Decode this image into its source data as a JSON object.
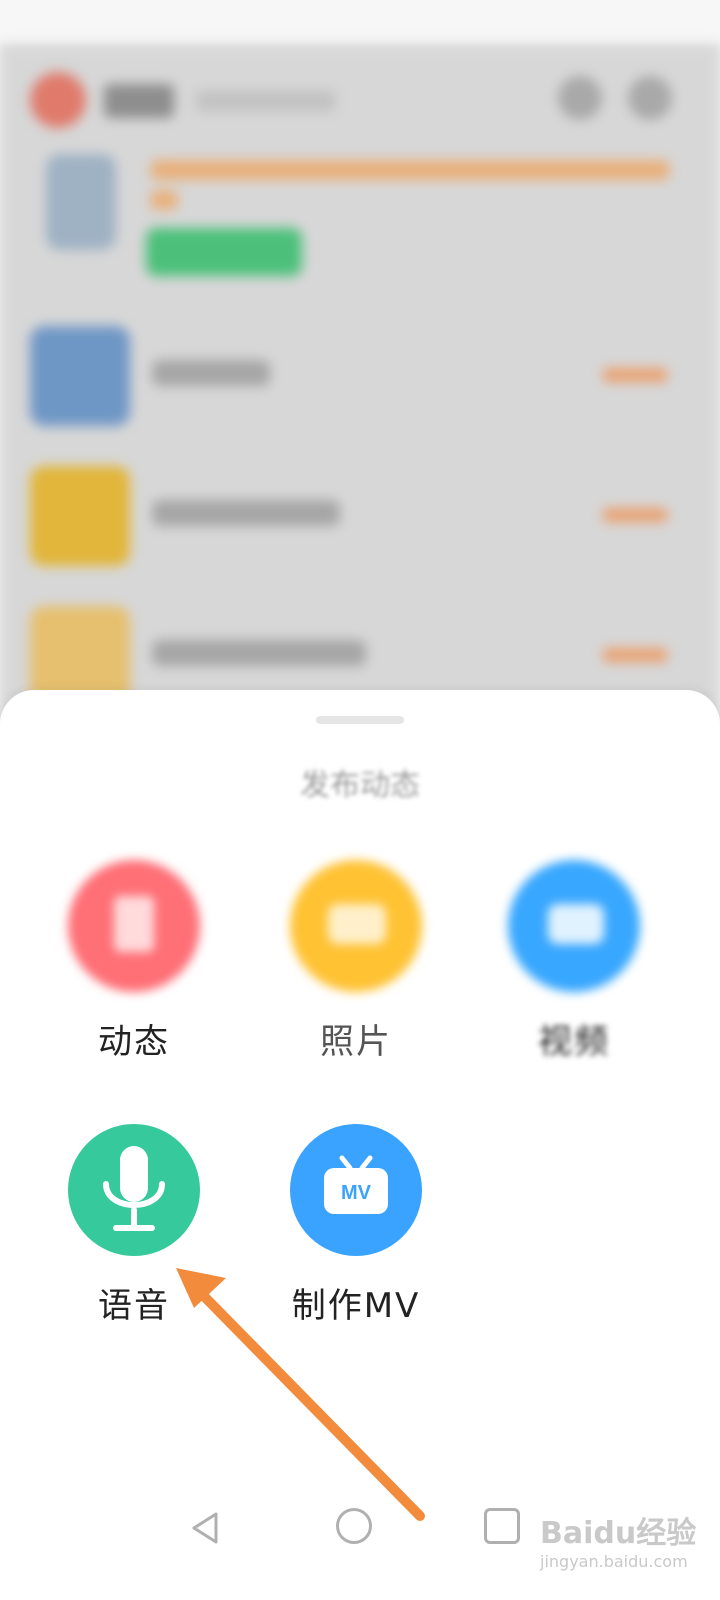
{
  "sheet": {
    "title": "发布动态",
    "actions": [
      {
        "label": "动态",
        "icon": "post-icon",
        "color": "#ff6f76"
      },
      {
        "label": "照片",
        "icon": "photo-icon",
        "color": "#ffc233"
      },
      {
        "label": "视频",
        "icon": "video-icon",
        "color": "#38a7ff"
      },
      {
        "label": "语音",
        "icon": "microphone-icon",
        "color": "#35c99b"
      },
      {
        "label": "制作MV",
        "icon": "mv-tv-icon",
        "color": "#3aa3ff",
        "badge_text": "MV"
      }
    ]
  },
  "watermark": {
    "brand": "Baidu经验",
    "sub": "jingyan.baidu.com"
  },
  "colors": {
    "arrow": "#f28b3b",
    "sheet_bg": "#ffffff"
  }
}
